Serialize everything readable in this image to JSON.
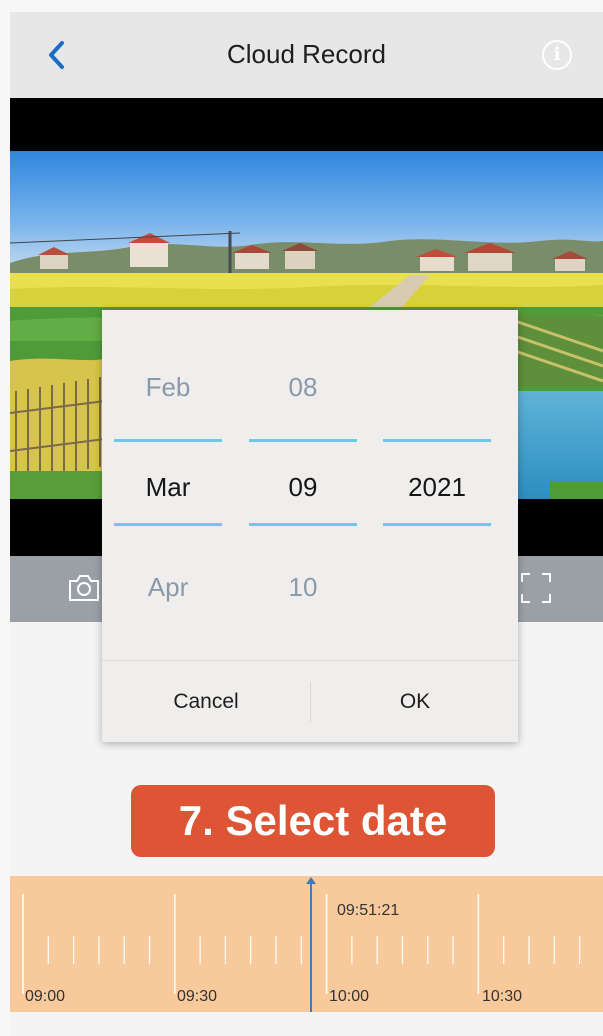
{
  "header": {
    "title": "Cloud Record",
    "back_icon": "chevron-left-icon",
    "info_icon": "info-icon",
    "info_glyph": "i",
    "accent": "#1a6fc4"
  },
  "controls": {
    "snapshot_icon": "camera-icon",
    "fullscreen_icon": "fullscreen-icon"
  },
  "date_picker": {
    "month": {
      "prev": "Feb",
      "current": "Mar",
      "next": "Apr"
    },
    "day": {
      "prev": "08",
      "current": "09",
      "next": "10"
    },
    "year": {
      "prev": "",
      "current": "2021",
      "next": ""
    },
    "cancel_label": "Cancel",
    "ok_label": "OK",
    "selection_line_color": "#6ec8e8"
  },
  "step_badge": {
    "text": "7. Select date",
    "color": "#dd5535"
  },
  "timeline": {
    "cursor_time": "09:51:21",
    "tick_labels": [
      "09:00",
      "09:30",
      "10:00",
      "10:30"
    ],
    "background": "#f8c99b",
    "cursor_color": "#3d7cc0"
  }
}
